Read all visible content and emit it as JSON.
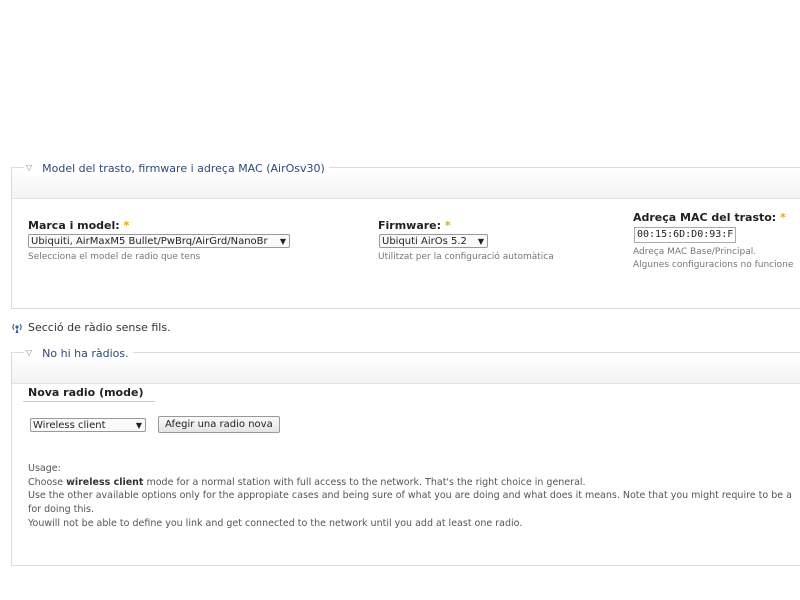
{
  "model_section": {
    "legend": "Model del trasto, firmware i adreça MAC (AirOsv30)",
    "brand_model": {
      "label": "Marca i model:",
      "required_mark": "*",
      "selected": "Ubiquiti, AirMaxM5 Bullet/PwBrq/AirGrd/NanoBr",
      "description": "Selecciona el model de radio que tens"
    },
    "firmware": {
      "label": "Firmware:",
      "required_mark": "*",
      "selected": "Ubiquti AirOs 5.2",
      "description": "Utilitzat per la configuració automàtica"
    },
    "mac": {
      "label": "Adreça MAC del trasto:",
      "required_mark": "*",
      "value": "00:15:6D:D0:93:F",
      "description_1": "Adreça MAC Base/Principal.",
      "description_2": "Algunes configuracions no funcione"
    }
  },
  "radio_section_heading": "Secció de ràdio sense fils.",
  "radios_section": {
    "legend": "No hi ha ràdios.",
    "new_radio_label": "Nova radio (mode)",
    "mode_selected": "Wireless client",
    "add_button": "Afegir una radio nova",
    "usage": {
      "title": "Usage:",
      "line1_pre": "Choose ",
      "line1_bold": "wireless client",
      "line1_post": " mode for a normal station with full access to the network. That's the right choice in general.",
      "line2": "Use the other available options only for the appropiate cases and being sure of what you are doing and what does it means. Note that you might require to be a",
      "line3": "for doing this.",
      "line4": "Youwill not be able to define you link and get connected to the network until you add at least one radio."
    }
  },
  "icons": {
    "collapse": "triangle-down-icon",
    "radio": "wireless-icon"
  },
  "colors": {
    "legend_text": "#2d4a7a",
    "required": "#e8a317"
  }
}
